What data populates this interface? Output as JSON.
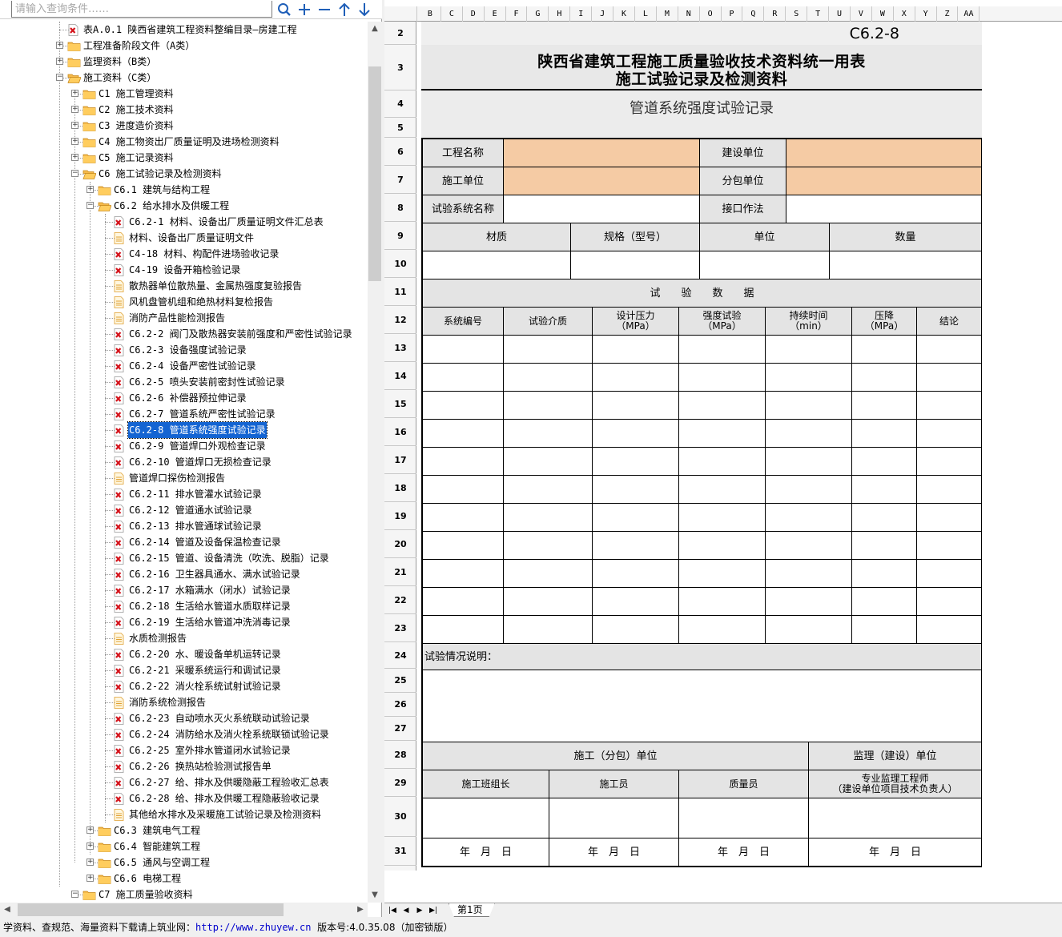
{
  "search": {
    "placeholder": "请输入查询条件……"
  },
  "toolbar": {
    "search_icon": "search-icon",
    "expand_icon": "plus-icon",
    "collapse_icon": "minus-icon",
    "up_icon": "arrow-up-icon",
    "down_icon": "arrow-down-icon"
  },
  "tree": {
    "items": [
      {
        "label": "表A.0.1 陕西省建筑工程资料整编目录—房建工程",
        "level": 3,
        "icon": "pdf",
        "expander": ""
      },
      {
        "label": "工程准备阶段文件（A类）",
        "level": 3,
        "icon": "folder",
        "expander": "+"
      },
      {
        "label": "监理资料（B类）",
        "level": 3,
        "icon": "folder",
        "expander": "+"
      },
      {
        "label": "施工资料（C类）",
        "level": 3,
        "icon": "folder-open",
        "expander": "-"
      },
      {
        "label": "C1 施工管理资料",
        "level": 4,
        "icon": "folder",
        "expander": "+"
      },
      {
        "label": "C2 施工技术资料",
        "level": 4,
        "icon": "folder",
        "expander": "+"
      },
      {
        "label": "C3 进度造价资料",
        "level": 4,
        "icon": "folder",
        "expander": "+"
      },
      {
        "label": "C4 施工物资出厂质量证明及进场检测资料",
        "level": 4,
        "icon": "folder",
        "expander": "+"
      },
      {
        "label": "C5 施工记录资料",
        "level": 4,
        "icon": "folder",
        "expander": "+"
      },
      {
        "label": "C6 施工试验记录及检测资料",
        "level": 4,
        "icon": "folder-open",
        "expander": "-"
      },
      {
        "label": "C6.1 建筑与结构工程",
        "level": 5,
        "icon": "folder",
        "expander": "+"
      },
      {
        "label": "C6.2 给水排水及供暖工程",
        "level": 5,
        "icon": "folder-open",
        "expander": "-"
      },
      {
        "label": "C6.2-1 材料、设备出厂质量证明文件汇总表",
        "level": 6,
        "icon": "pdf",
        "expander": ""
      },
      {
        "label": "材料、设备出厂质量证明文件",
        "level": 6,
        "icon": "doc",
        "expander": ""
      },
      {
        "label": "C4-18 材料、构配件进场验收记录",
        "level": 6,
        "icon": "pdf",
        "expander": ""
      },
      {
        "label": "C4-19 设备开箱检验记录",
        "level": 6,
        "icon": "pdf",
        "expander": ""
      },
      {
        "label": "散热器单位散热量、金属热强度复验报告",
        "level": 6,
        "icon": "doc",
        "expander": ""
      },
      {
        "label": "风机盘管机组和绝热材料复检报告",
        "level": 6,
        "icon": "doc",
        "expander": ""
      },
      {
        "label": "消防产品性能检测报告",
        "level": 6,
        "icon": "doc",
        "expander": ""
      },
      {
        "label": "C6.2-2 阀门及散热器安装前强度和严密性试验记录",
        "level": 6,
        "icon": "pdf",
        "expander": ""
      },
      {
        "label": "C6.2-3 设备强度试验记录",
        "level": 6,
        "icon": "pdf",
        "expander": ""
      },
      {
        "label": "C6.2-4 设备严密性试验记录",
        "level": 6,
        "icon": "pdf",
        "expander": ""
      },
      {
        "label": "C6.2-5 喷头安装前密封性试验记录",
        "level": 6,
        "icon": "pdf",
        "expander": ""
      },
      {
        "label": "C6.2-6 补偿器预拉伸记录",
        "level": 6,
        "icon": "pdf",
        "expander": ""
      },
      {
        "label": "C6.2-7 管道系统严密性试验记录",
        "level": 6,
        "icon": "pdf",
        "expander": ""
      },
      {
        "label": "C6.2-8 管道系统强度试验记录",
        "level": 6,
        "icon": "pdf",
        "expander": "",
        "selected": true
      },
      {
        "label": "C6.2-9 管道焊口外观检查记录",
        "level": 6,
        "icon": "pdf",
        "expander": ""
      },
      {
        "label": "C6.2-10 管道焊口无损检查记录",
        "level": 6,
        "icon": "pdf",
        "expander": ""
      },
      {
        "label": "管道焊口探伤检测报告",
        "level": 6,
        "icon": "doc",
        "expander": ""
      },
      {
        "label": "C6.2-11 排水管灌水试验记录",
        "level": 6,
        "icon": "pdf",
        "expander": ""
      },
      {
        "label": "C6.2-12 管道通水试验记录",
        "level": 6,
        "icon": "pdf",
        "expander": ""
      },
      {
        "label": "C6.2-13 排水管通球试验记录",
        "level": 6,
        "icon": "pdf",
        "expander": ""
      },
      {
        "label": "C6.2-14 管道及设备保温检查记录",
        "level": 6,
        "icon": "pdf",
        "expander": ""
      },
      {
        "label": "C6.2-15 管道、设备清洗（吹洗、脱脂）记录",
        "level": 6,
        "icon": "pdf",
        "expander": ""
      },
      {
        "label": "C6.2-16 卫生器具通水、满水试验记录",
        "level": 6,
        "icon": "pdf",
        "expander": ""
      },
      {
        "label": "C6.2-17 水箱满水（闭水）试验记录",
        "level": 6,
        "icon": "pdf",
        "expander": ""
      },
      {
        "label": "C6.2-18 生活给水管道水质取样记录",
        "level": 6,
        "icon": "pdf",
        "expander": ""
      },
      {
        "label": "C6.2-19 生活给水管道冲洗消毒记录",
        "level": 6,
        "icon": "pdf",
        "expander": ""
      },
      {
        "label": "水质检测报告",
        "level": 6,
        "icon": "doc",
        "expander": ""
      },
      {
        "label": "C6.2-20 水、暖设备单机运转记录",
        "level": 6,
        "icon": "pdf",
        "expander": ""
      },
      {
        "label": "C6.2-21 采暖系统运行和调试记录",
        "level": 6,
        "icon": "pdf",
        "expander": ""
      },
      {
        "label": "C6.2-22 消火栓系统试射试验记录",
        "level": 6,
        "icon": "pdf",
        "expander": ""
      },
      {
        "label": "消防系统检测报告",
        "level": 6,
        "icon": "doc",
        "expander": ""
      },
      {
        "label": "C6.2-23 自动喷水灭火系统联动试验记录",
        "level": 6,
        "icon": "pdf",
        "expander": ""
      },
      {
        "label": "C6.2-24 消防给水及消火栓系统联锁试验记录",
        "level": 6,
        "icon": "pdf",
        "expander": ""
      },
      {
        "label": "C6.2-25 室外排水管道闭水试验记录",
        "level": 6,
        "icon": "pdf",
        "expander": ""
      },
      {
        "label": "C6.2-26 换热站检验测试报告单",
        "level": 6,
        "icon": "pdf",
        "expander": ""
      },
      {
        "label": "C6.2-27 给、排水及供暖隐蔽工程验收汇总表",
        "level": 6,
        "icon": "pdf",
        "expander": ""
      },
      {
        "label": "C6.2-28 给、排水及供暖工程隐蔽验收记录",
        "level": 6,
        "icon": "pdf",
        "expander": ""
      },
      {
        "label": "其他给水排水及采暖施工试验记录及检测资料",
        "level": 6,
        "icon": "doc",
        "expander": ""
      },
      {
        "label": "C6.3 建筑电气工程",
        "level": 5,
        "icon": "folder",
        "expander": "+"
      },
      {
        "label": "C6.4 智能建筑工程",
        "level": 5,
        "icon": "folder",
        "expander": "+"
      },
      {
        "label": "C6.5 通风与空调工程",
        "level": 5,
        "icon": "folder",
        "expander": "+"
      },
      {
        "label": "C6.6 电梯工程",
        "level": 5,
        "icon": "folder",
        "expander": "+"
      },
      {
        "label": "C7 施工质量验收资料",
        "level": 4,
        "icon": "folder",
        "expander": "-"
      }
    ]
  },
  "sheet": {
    "columns": [
      "B",
      "C",
      "D",
      "E",
      "F",
      "G",
      "H",
      "I",
      "J",
      "K",
      "L",
      "M",
      "N",
      "O",
      "P",
      "Q",
      "R",
      "S",
      "T",
      "U",
      "V",
      "W",
      "X",
      "Y",
      "Z",
      "AA"
    ],
    "rows": [
      "2",
      "3",
      "4",
      "5",
      "6",
      "7",
      "8",
      "9",
      "10",
      "11",
      "12",
      "13",
      "14",
      "15",
      "16",
      "17",
      "18",
      "19",
      "20",
      "21",
      "22",
      "23",
      "24",
      "25",
      "26",
      "27",
      "28",
      "29",
      "30",
      "31"
    ],
    "form_no": "C6.2-8",
    "title_line1": "陕西省建筑工程施工质量验收技术资料统一用表",
    "title_line2": "施工试验记录及检测资料",
    "subtitle": "管道系统强度试验记录",
    "project_name": "工程名称",
    "construction_unit": "建设单位",
    "builder": "施工单位",
    "subcontractor": "分包单位",
    "test_system": "试验系统名称",
    "joint_method": "接口作法",
    "material": "材质",
    "spec": "规格（型号）",
    "unit": "单位",
    "quantity": "数量",
    "test_data": "试　　验　　数　　据",
    "cols": [
      "系统编号",
      "试验介质",
      "设计压力\n（MPa）",
      "强度试验\n（MPa）",
      "持续时间\n（min）",
      "压降\n（MPa）",
      "结论"
    ],
    "notes_label": "试验情况说明：",
    "construction_sub": "施工（分包）单位",
    "supervision": "监理（建设）单位",
    "team_leader": "施工班组长",
    "worker": "施工员",
    "inspector": "质量员",
    "engineer": "专业监理工程师\n（建设单位项目技术负责人）",
    "date": "年　月　日"
  },
  "tabs": {
    "sheet1": "第1页"
  },
  "status": {
    "prefix": "学资料、查规范、海量资料下载请上筑业网：",
    "url": "http://www.zhuyew.cn",
    "suffix": "版本号:4.0.35.08（加密锁版）"
  },
  "colors": {
    "peach": "#f5cba4",
    "header_gray": "#e4e4e4",
    "selection": "#1464d2"
  }
}
